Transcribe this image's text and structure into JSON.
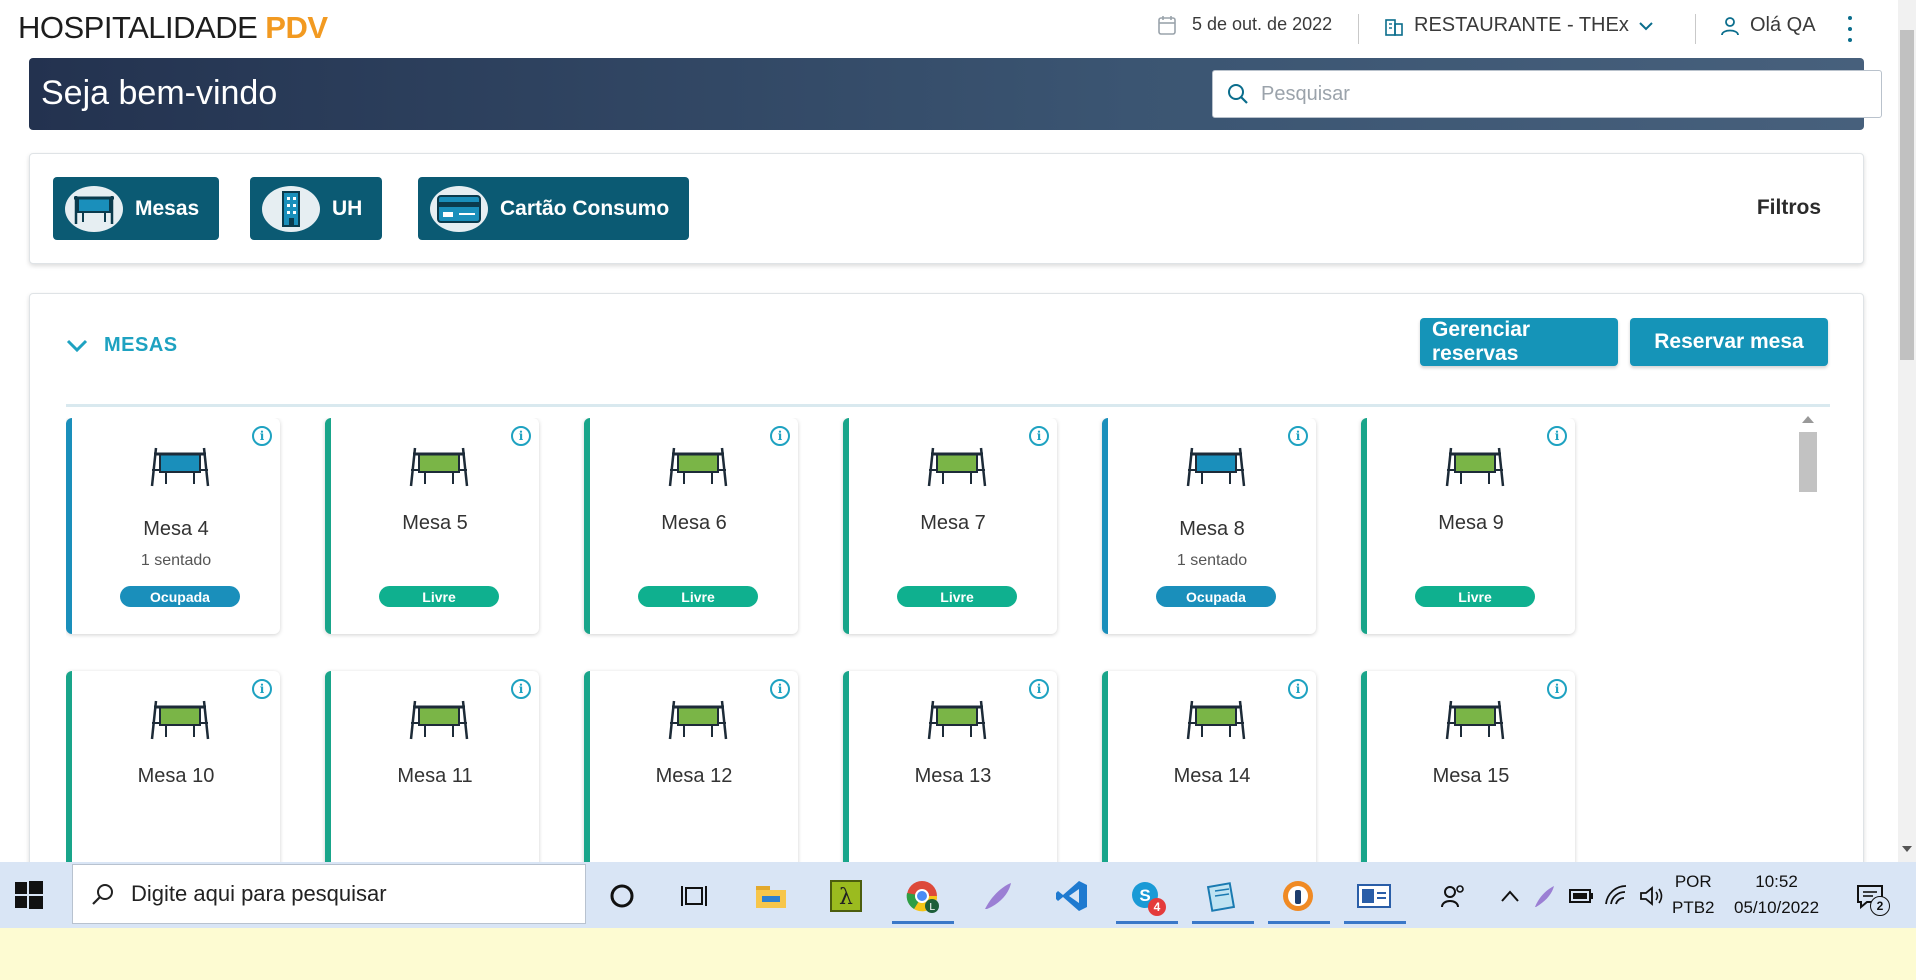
{
  "header": {
    "brand_main": "HOSPITALIDADE",
    "brand_accent": "PDV",
    "date": "5 de out. de 2022",
    "restaurant": "RESTAURANTE - THEx",
    "user_greeting": "Olá QA"
  },
  "banner": {
    "title": "Seja bem-vindo",
    "search_placeholder": "Pesquisar"
  },
  "categories": {
    "items": [
      {
        "label": "Mesas",
        "icon": "table-icon"
      },
      {
        "label": "UH",
        "icon": "building-icon"
      },
      {
        "label": "Cartão Consumo",
        "icon": "card-icon"
      }
    ],
    "filters_label": "Filtros"
  },
  "section": {
    "title": "MESAS",
    "manage_label": "Gerenciar reservas",
    "reserve_label": "Reservar mesa"
  },
  "tables": [
    {
      "name": "Mesa 4",
      "seated": "1 sentado",
      "status": "Ocupada"
    },
    {
      "name": "Mesa 5",
      "seated": "",
      "status": "Livre"
    },
    {
      "name": "Mesa 6",
      "seated": "",
      "status": "Livre"
    },
    {
      "name": "Mesa 7",
      "seated": "",
      "status": "Livre"
    },
    {
      "name": "Mesa 8",
      "seated": "1 sentado",
      "status": "Ocupada"
    },
    {
      "name": "Mesa 9",
      "seated": "",
      "status": "Livre"
    },
    {
      "name": "Mesa 10",
      "seated": "",
      "status": ""
    },
    {
      "name": "Mesa 11",
      "seated": "",
      "status": ""
    },
    {
      "name": "Mesa 12",
      "seated": "",
      "status": ""
    },
    {
      "name": "Mesa 13",
      "seated": "",
      "status": ""
    },
    {
      "name": "Mesa 14",
      "seated": "",
      "status": ""
    },
    {
      "name": "Mesa 15",
      "seated": "",
      "status": ""
    }
  ],
  "colors": {
    "free": "#0fb08f",
    "occupied": "#1a8fbb",
    "table_free_fill": "#7ab547",
    "table_occupied_fill": "#1a8fbb"
  },
  "taskbar": {
    "search_placeholder": "Digite aqui para pesquisar",
    "language": "POR",
    "keyboard": "PTB2",
    "time": "10:52",
    "date": "05/10/2022",
    "skype_badge": "4",
    "notifications_badge": "2"
  }
}
